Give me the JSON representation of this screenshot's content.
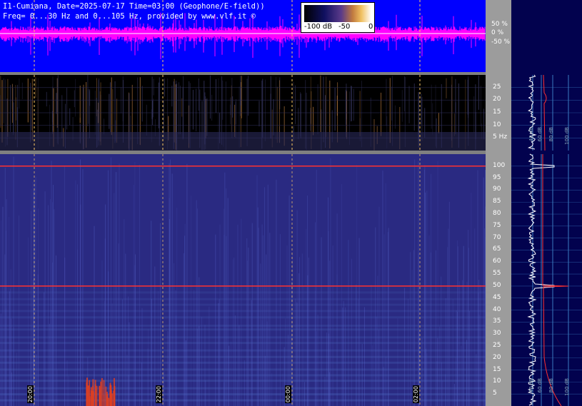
{
  "header": {
    "line1": "I1-Cumiana, Date=2025-07-17 Time=03:00 (Geophone/E-field))",
    "line2": "Freq= 0...30 Hz and 0...105 Hz, provided by www.vlf.it ©"
  },
  "colorbar": {
    "labels": [
      "-100 dB",
      "-50",
      "0"
    ]
  },
  "colors": {
    "wave_bg": "#0000ff",
    "wave_trace": "#ff00ff",
    "spec_low": "#2a2a82",
    "red_line": "#ff3030",
    "grid": "#3a7ac0"
  },
  "chart_data": [
    {
      "type": "line",
      "name": "waveform",
      "y_ticks": [
        "50 %",
        "0 %",
        "-50 %"
      ],
      "ylim": [
        -100,
        100
      ]
    },
    {
      "type": "heatmap",
      "name": "spectrogram-low",
      "y_ticks": [
        "25",
        "20",
        "15",
        "10",
        "5 Hz"
      ],
      "ylim": [
        0,
        30
      ],
      "spectrum_db_ticks": [
        "40 dB",
        "60 dB",
        "80 dB",
        "100 dB"
      ]
    },
    {
      "type": "heatmap",
      "name": "spectrogram-high",
      "y_ticks": [
        "100",
        "95",
        "90",
        "85",
        "80",
        "75",
        "70",
        "65",
        "60",
        "55",
        "50",
        "45",
        "40",
        "35",
        "30",
        "25",
        "20",
        "15",
        "10",
        "5"
      ],
      "ylim": [
        0,
        105
      ],
      "x_ticks": [
        "20:00",
        "22:00",
        "00:00",
        "02:00"
      ],
      "spectrum_db_ticks": [
        "40 dB",
        "60 dB",
        "80 dB",
        "100 dB"
      ],
      "mains_lines_hz": [
        50,
        100
      ]
    }
  ]
}
